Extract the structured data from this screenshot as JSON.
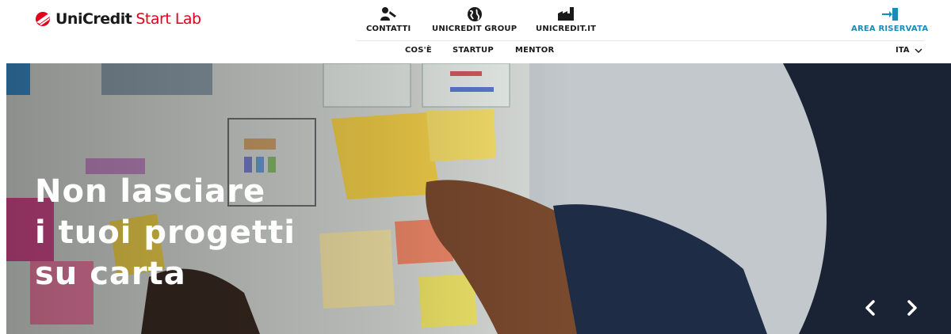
{
  "brand": {
    "name": "UniCredit",
    "product": "Start Lab",
    "accent_color": "#e2001a",
    "link_color": "#1b8cb5"
  },
  "quicklinks": [
    {
      "label": "CONTATTI",
      "icon": "phone-person-icon"
    },
    {
      "label": "UNICREDIT GROUP",
      "icon": "globe-icon"
    },
    {
      "label": "UNICREDIT.IT",
      "icon": "factory-icon"
    }
  ],
  "area_riservata": {
    "label": "AREA RISERVATA",
    "icon": "login-door-icon"
  },
  "mainnav": [
    {
      "label": "COS'È"
    },
    {
      "label": "STARTUP"
    },
    {
      "label": "MENTOR"
    }
  ],
  "language": {
    "label": "ITA",
    "icon": "chevron-down-icon"
  },
  "hero": {
    "headline": [
      "Non lasciare",
      "i tuoi progetti",
      "su carta"
    ],
    "prev_icon": "chevron-left-icon",
    "next_icon": "chevron-right-icon"
  }
}
